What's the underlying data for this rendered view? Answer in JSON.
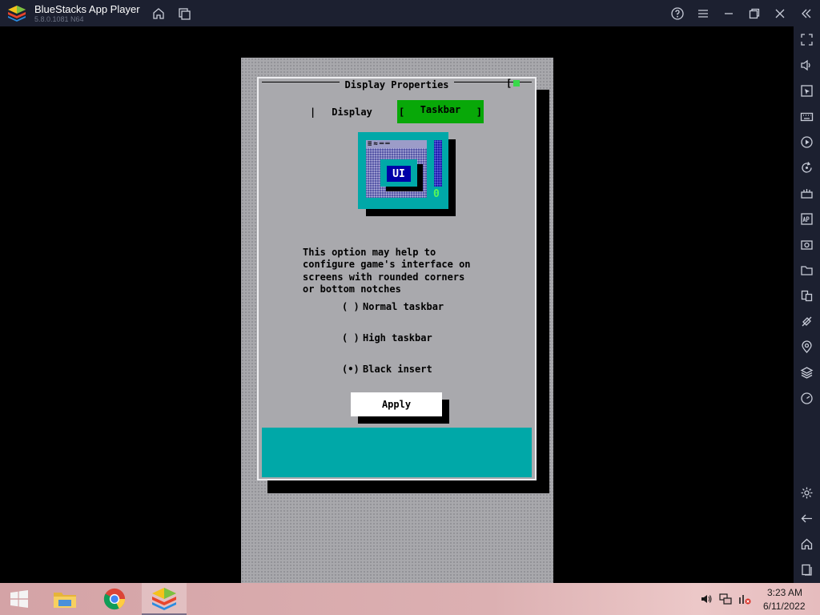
{
  "window": {
    "title": "BlueStacks App Player",
    "version": "5.8.0.1081 N64"
  },
  "titlebar_buttons": [
    "home-icon",
    "multi-instance-icon",
    "help-icon",
    "menu-icon",
    "minimize-icon",
    "restore-icon",
    "close-icon",
    "collapse-sidebar-icon"
  ],
  "sidebar_buttons": [
    "fullscreen-icon",
    "volume-icon",
    "cursor-icon",
    "keyboard-icon",
    "record-icon",
    "rotate-icon",
    "macro-icon",
    "apk-icon",
    "screenshot-icon",
    "folder-icon",
    "multi-instance-icon",
    "eco-mode-icon",
    "location-icon",
    "layers-icon",
    "performance-icon",
    "settings-icon",
    "back-icon",
    "home-icon",
    "recent-apps-icon"
  ],
  "dialog": {
    "title": "Display Properties",
    "close_glyph": "[",
    "tabs": {
      "display": "Display",
      "taskbar": "Taskbar",
      "bracket_open": "[",
      "bracket_close": "]",
      "separator": "|"
    },
    "illustration": {
      "title_glyphs": "≡≈══",
      "ui_label": "UI",
      "counter": "0"
    },
    "description": "This option may help to\nconfigure game's interface on\nscreens with rounded corners\nor bottom notches",
    "options": [
      {
        "mark": "( )",
        "label": "Normal taskbar",
        "selected": false
      },
      {
        "mark": "( )",
        "label": "High taskbar",
        "selected": false
      },
      {
        "mark": "(•)",
        "label": "Black insert",
        "selected": true
      }
    ],
    "apply_label": "Apply"
  },
  "taskbar": {
    "apps": [
      "file-explorer-icon",
      "chrome-icon",
      "bluestacks-icon"
    ],
    "clock_time": "3:23 AM",
    "clock_date": "6/11/2022"
  },
  "colors": {
    "chrome_bg": "#1c2030",
    "game_bg": "#a8a8ac",
    "tab_active": "#08a808",
    "teal": "#00a8a8"
  }
}
